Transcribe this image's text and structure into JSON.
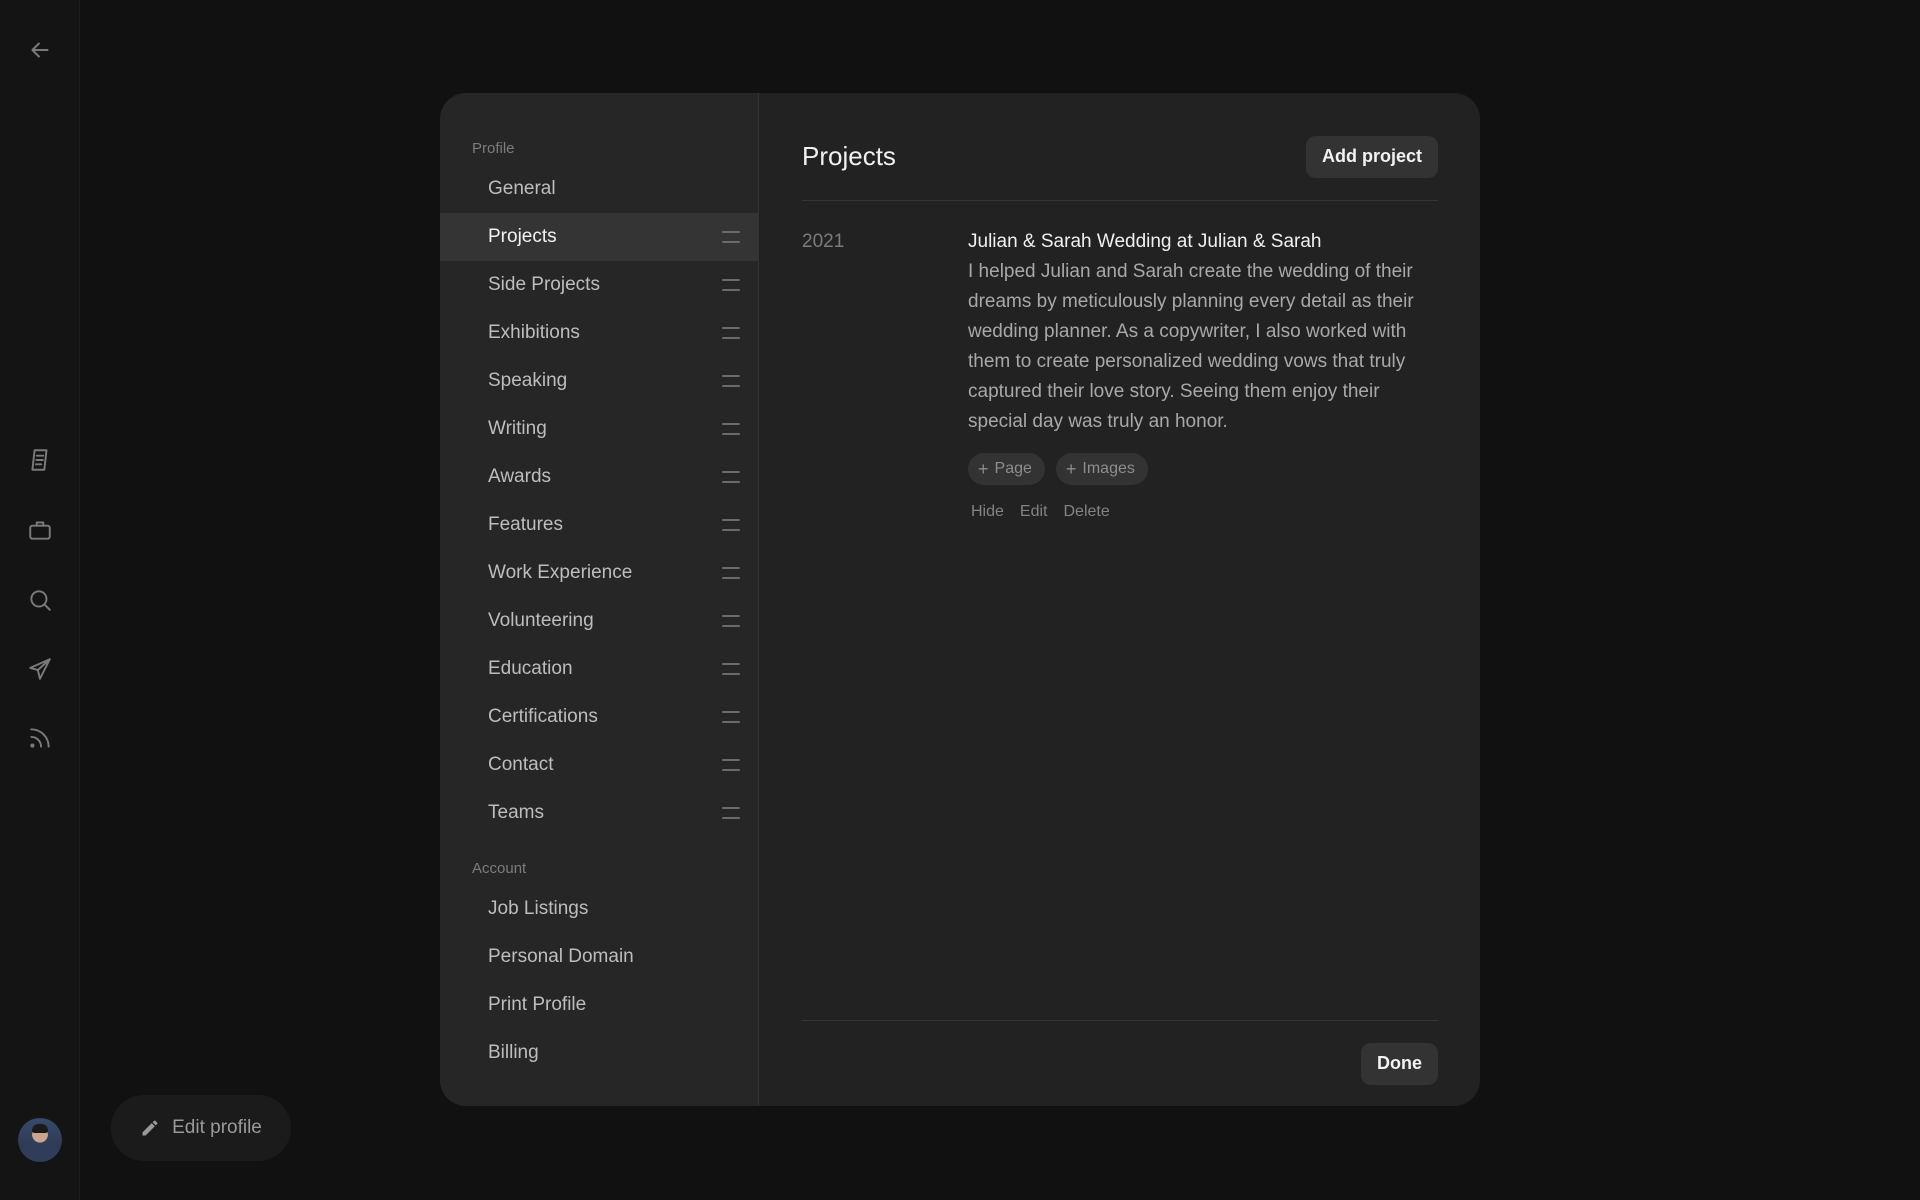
{
  "rail": {
    "icons": [
      "arrow-left-icon",
      "document-icon",
      "briefcase-icon",
      "search-icon",
      "send-icon",
      "rss-icon"
    ]
  },
  "edit_profile": {
    "label": "Edit profile",
    "icon": "pencil-icon"
  },
  "sidebar": {
    "profile_label": "Profile",
    "profile_items": [
      {
        "label": "General"
      },
      {
        "label": "Projects"
      },
      {
        "label": "Side Projects"
      },
      {
        "label": "Exhibitions"
      },
      {
        "label": "Speaking"
      },
      {
        "label": "Writing"
      },
      {
        "label": "Awards"
      },
      {
        "label": "Features"
      },
      {
        "label": "Work Experience"
      },
      {
        "label": "Volunteering"
      },
      {
        "label": "Education"
      },
      {
        "label": "Certifications"
      },
      {
        "label": "Contact"
      },
      {
        "label": "Teams"
      }
    ],
    "account_label": "Account",
    "account_items": [
      {
        "label": "Job Listings"
      },
      {
        "label": "Personal Domain"
      },
      {
        "label": "Print Profile"
      },
      {
        "label": "Billing"
      }
    ]
  },
  "main": {
    "title": "Projects",
    "add_label": "Add project",
    "entry": {
      "year": "2021",
      "title": "Julian & Sarah Wedding at Julian & Sarah",
      "description": "I helped Julian and Sarah create the wedding of their dreams by meticulously planning every detail as their wedding planner. As a copywriter, I also worked with them to create personalized wedding vows that truly captured their love story. Seeing them enjoy their special day was truly an honor.",
      "chips": [
        "Page",
        "Images"
      ],
      "actions": [
        "Hide",
        "Edit",
        "Delete"
      ]
    },
    "done_label": "Done"
  }
}
